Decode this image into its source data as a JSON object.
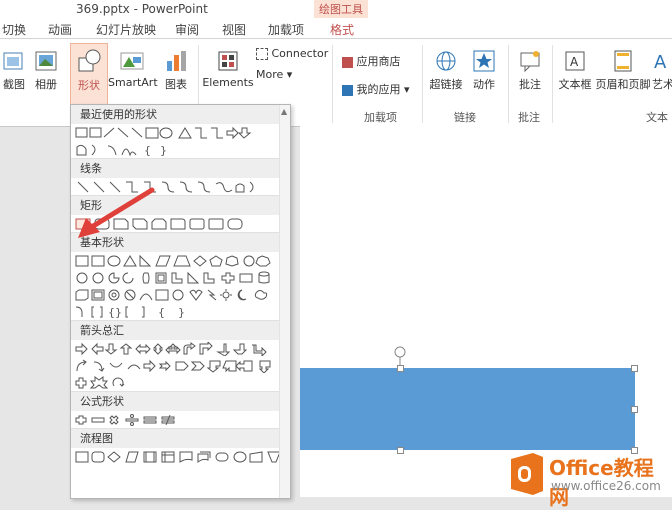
{
  "window": {
    "title": "369.pptx - PowerPoint"
  },
  "context_tab": {
    "group": "绘图工具",
    "tab": "格式"
  },
  "tabs": [
    "切换",
    "动画",
    "幻灯片放映",
    "审阅",
    "视图",
    "加载项"
  ],
  "ribbon": {
    "screenshot": "截图",
    "album": "相册",
    "shapes": "形状",
    "smartart": "SmartArt",
    "chart": "图表",
    "elements": "Elements",
    "connector": "Connector",
    "more": "More",
    "app_store": "应用商店",
    "my_apps": "我的应用",
    "addins_group": "加载项",
    "hyperlink": "超链接",
    "action": "动作",
    "links_group": "链接",
    "comment": "批注",
    "comment_group": "批注",
    "textbox": "文本框",
    "header_footer": "页眉和页脚",
    "wordart": "艺术",
    "text_group": "文本"
  },
  "shapes_panel": {
    "sections": [
      "最近使用的形状",
      "线条",
      "矩形",
      "基本形状",
      "箭头总汇",
      "公式形状",
      "流程图"
    ]
  },
  "watermark": {
    "brand": "Office教程网",
    "url": "www.office26.com"
  },
  "colors": {
    "shape_fill": "#5b9bd5",
    "accent": "#c0504d",
    "logo_orange": "#e8731c"
  }
}
